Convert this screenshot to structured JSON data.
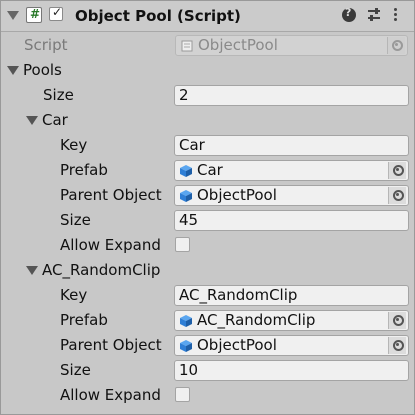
{
  "header": {
    "title": "Object Pool (Script)",
    "enabled_checkbox": true,
    "help_icon": "help-icon",
    "settings_icon": "sliders-icon",
    "menu_icon": "kebab-menu-icon"
  },
  "script_row": {
    "label": "Script",
    "value": "ObjectPool"
  },
  "pools": {
    "label": "Pools",
    "size_label": "Size",
    "size_value": "2",
    "elements": [
      {
        "name": "Car",
        "key_label": "Key",
        "key_value": "Car",
        "prefab_label": "Prefab",
        "prefab_value": "Car",
        "parent_label": "Parent Object",
        "parent_value": "ObjectPool",
        "size_label": "Size",
        "size_value": "45",
        "allow_label": "Allow Expand",
        "allow_value": false
      },
      {
        "name": "AC_RandomClip",
        "key_label": "Key",
        "key_value": "AC_RandomClip",
        "prefab_label": "Prefab",
        "prefab_value": "AC_RandomClip",
        "parent_label": "Parent Object",
        "parent_value": "ObjectPool",
        "size_label": "Size",
        "size_value": "10",
        "allow_label": "Allow Expand",
        "allow_value": false
      }
    ]
  },
  "colors": {
    "background": "#c8c8c8",
    "field": "#f0f0f0",
    "cube_icon": "#2f7fd6"
  }
}
